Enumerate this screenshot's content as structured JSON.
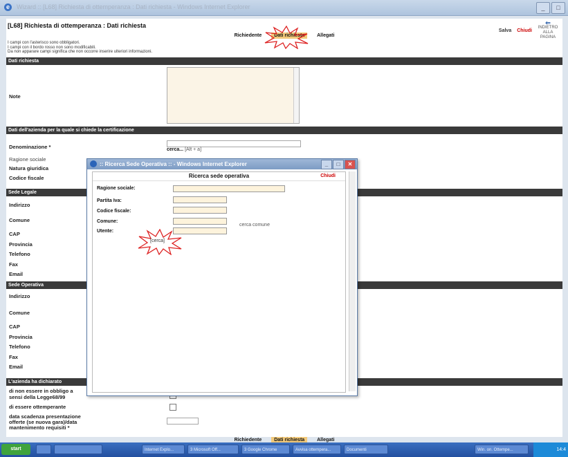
{
  "window": {
    "title": "Wizard :: [L68] Richiesta di ottemperanza : Dati richiesta - Windows Internet Explorer",
    "ie_icon": "ie-icon"
  },
  "header": {
    "title": "[L68] Richiesta di ottemperanza : Dati richiesta",
    "salva": "Salva",
    "chiudi": "Chiudi",
    "back_label": "INDIETRO ALLA PAGINA"
  },
  "tabs": [
    "Richiedente",
    "Dati richiesta",
    "Allegati"
  ],
  "notes": [
    "I campi con l'asterisco sono obbligatori.",
    "I campi con il bordo rosso non sono modificabili.",
    "Da non apparare campi significa che non occorre inserire ulteriori informazioni."
  ],
  "sections": {
    "dati_richiesta": "Dati richiesta",
    "azienda": "Dati dell'azienda per la quale si chiede la certificazione",
    "sede_legale": "Sede Legale",
    "sede_operativa": "Sede Operativa",
    "dichiarato": "L'azienda ha dichiarato"
  },
  "labels": {
    "note": "Note",
    "denominazione": "Denominazione *",
    "cerca": "cerca...",
    "cerca_hint": "[Alt + a]",
    "ragione_sociale": "Ragione sociale",
    "natura_giuridica": "Natura giuridica",
    "codice_fiscale": "Codice fiscale",
    "indirizzo": "Indirizzo",
    "comune": "Comune",
    "cap": "CAP",
    "provincia": "Provincia",
    "telefono": "Telefono",
    "fax": "Fax",
    "email": "Email",
    "indirizzo2": "Indirizzo",
    "comune2": "Comune",
    "cap2": "CAP",
    "provincia2": "Provincia",
    "telefono2": "Telefono",
    "fax2": "Fax",
    "email2": "Email",
    "obbligo_1": "di non essere in obbligo a",
    "obbligo_2": "sensi della Legge68/99",
    "ottemperante": "di essere ottemperante",
    "scadenza_1": "data scadenza presentazione",
    "scadenza_2": "offerte (se nuova gara)/data",
    "scadenza_3": "mantenimento requisiti *"
  },
  "popup": {
    "title": ":: Ricerca Sede Operativa :: - Windows Internet Explorer",
    "header": "Ricerca sede operativa",
    "chiudi": "Chiudi",
    "ragione_sociale": "Ragione sociale:",
    "partita_iva": "Partita Iva:",
    "codice_fiscale": "Codice fiscale:",
    "comune": "Comune:",
    "utente": "Utente:",
    "cerca_comune": "cerca comune",
    "cerca": "[cerca]"
  },
  "taskbar": {
    "start": "start",
    "items": [
      "",
      "",
      "Internet Explo...",
      "3 Microsoft Off...",
      "3 Google Chrome",
      "Avvisa ottempera...",
      "Documenti",
      "Win. on. Ottempe..."
    ],
    "clock": "14:4"
  }
}
